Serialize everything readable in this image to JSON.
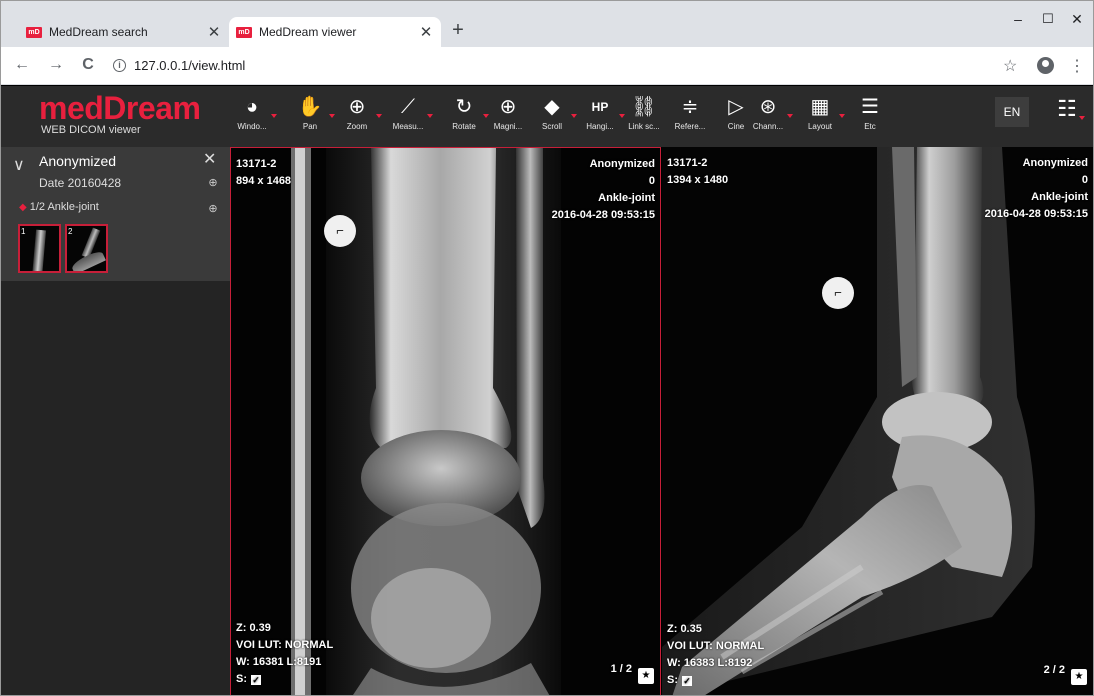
{
  "browser": {
    "tabs": [
      {
        "favicon": "mD",
        "title": "MedDream search",
        "close": "✕"
      },
      {
        "favicon": "mD",
        "title": "MedDream viewer",
        "close": "✕"
      }
    ],
    "new_tab": "+",
    "window_controls": {
      "minimize": "–",
      "maximize": "☐",
      "close": "✕"
    },
    "nav": {
      "back": "←",
      "forward": "→",
      "reload": "C"
    },
    "info_glyph": "i",
    "url": "127.0.0.1/view.html",
    "star": "☆",
    "menu": "⋮"
  },
  "app": {
    "logo": "medDream",
    "logo_subtitle": "WEB DICOM viewer",
    "tools": [
      {
        "label": "Windo...",
        "icon": "window-level-icon",
        "glyph": "◕",
        "dropdown": true
      },
      {
        "label": "Pan",
        "icon": "pan-hand-icon",
        "glyph": "✋",
        "dropdown": true
      },
      {
        "label": "Zoom",
        "icon": "zoom-icon",
        "glyph": "⊕",
        "dropdown": true
      },
      {
        "label": "Measu...",
        "icon": "measure-icon",
        "glyph": "⟋",
        "dropdown": true
      },
      {
        "label": "Rotate",
        "icon": "rotate-icon",
        "glyph": "↻",
        "dropdown": true
      },
      {
        "label": "Magni...",
        "icon": "magnifier-icon",
        "glyph": "⊕",
        "dropdown": false
      },
      {
        "label": "Scroll",
        "icon": "scroll-layers-icon",
        "glyph": "◆",
        "dropdown": true
      },
      {
        "label": "Hangi...",
        "icon": "hanging-protocol-icon",
        "glyph": "HP",
        "dropdown": true
      },
      {
        "label": "Link sc...",
        "icon": "link-scroll-icon",
        "glyph": "⛓",
        "dropdown": false
      },
      {
        "label": "Refere...",
        "icon": "reference-lines-icon",
        "glyph": "≑",
        "dropdown": false
      },
      {
        "label": "Cine",
        "icon": "cine-play-icon",
        "glyph": "▷",
        "dropdown": false
      },
      {
        "label": "Chann...",
        "icon": "channels-icon",
        "glyph": "⊛",
        "dropdown": true
      },
      {
        "label": "Layout",
        "icon": "layout-grid-icon",
        "glyph": "▦",
        "dropdown": true
      },
      {
        "label": "Etc",
        "icon": "menu-icon",
        "glyph": "☰",
        "dropdown": false
      }
    ],
    "language": "EN",
    "settings_glyph": "☷"
  },
  "sidebar": {
    "patient_name": "Anonymized",
    "study_date": "Date 20160428",
    "close_glyph": "✕",
    "chevron_glyph": "∨",
    "cloud_glyph": "⊕",
    "series_label": "1/2 Ankle-joint",
    "series_glyph": "◆",
    "thumbnails": [
      {
        "number": "1"
      },
      {
        "number": "2"
      }
    ]
  },
  "viewports": [
    {
      "top_left": [
        "13171-2",
        "894 x 1468"
      ],
      "top_right": [
        "Anonymized",
        "0",
        "Ankle-joint",
        "2016-04-28 09:53:15"
      ],
      "bottom_left": [
        "Z: 0.39",
        "VOI LUT: NORMAL",
        "W: 16381 L:8191",
        "S:"
      ],
      "index": "1 / 2",
      "marker": "⌐"
    },
    {
      "top_left": [
        "13171-2",
        "1394 x 1480"
      ],
      "top_right": [
        "Anonymized",
        "0",
        "Ankle-joint",
        "2016-04-28 09:53:15"
      ],
      "bottom_left": [
        "Z: 0.35",
        "VOI LUT: NORMAL",
        "W: 16383 L:8192",
        "S:"
      ],
      "index": "2 / 2",
      "marker": "⌐"
    }
  ],
  "checkbox_glyph": "✓",
  "save_glyph": "★"
}
